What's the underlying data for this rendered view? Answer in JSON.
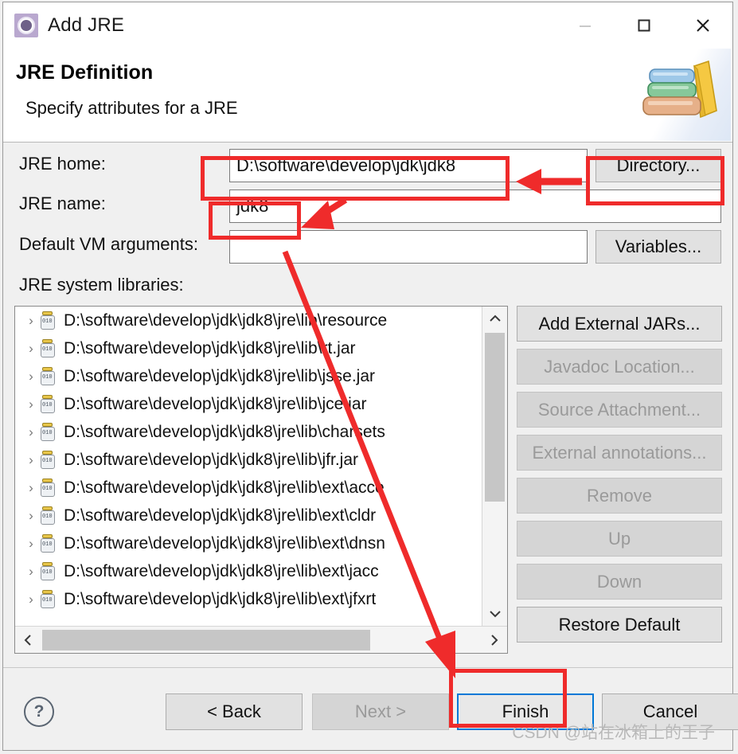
{
  "window": {
    "title": "Add JRE",
    "icon": "eclipse-jre-icon",
    "controls": {
      "minimize": "–",
      "maximize": "☐",
      "close": "✕"
    }
  },
  "header": {
    "title": "JRE Definition",
    "subtitle": "Specify attributes for a JRE",
    "art": "books-stack-image"
  },
  "form": {
    "jre_home": {
      "label": "JRE home:",
      "value": "D:\\software\\develop\\jdk\\jdk8",
      "button": "Directory..."
    },
    "jre_name": {
      "label": "JRE name:",
      "value": "jdk8"
    },
    "vm_args": {
      "label": "Default VM arguments:",
      "value": "",
      "button": "Variables..."
    },
    "libraries_label": "JRE system libraries:"
  },
  "libraries": [
    {
      "text": "D:\\software\\develop\\jdk\\jdk8\\jre\\lib\\resource",
      "icon": "jar-icon"
    },
    {
      "text": "D:\\software\\develop\\jdk\\jdk8\\jre\\lib\\rt.jar",
      "icon": "jar-icon"
    },
    {
      "text": "D:\\software\\develop\\jdk\\jdk8\\jre\\lib\\jsse.jar",
      "icon": "jar-icon"
    },
    {
      "text": "D:\\software\\develop\\jdk\\jdk8\\jre\\lib\\jce.jar",
      "icon": "jar-icon"
    },
    {
      "text": "D:\\software\\develop\\jdk\\jdk8\\jre\\lib\\charsets",
      "icon": "jar-icon"
    },
    {
      "text": "D:\\software\\develop\\jdk\\jdk8\\jre\\lib\\jfr.jar",
      "icon": "jar-icon"
    },
    {
      "text": "D:\\software\\develop\\jdk\\jdk8\\jre\\lib\\ext\\acce",
      "icon": "jar-icon"
    },
    {
      "text": "D:\\software\\develop\\jdk\\jdk8\\jre\\lib\\ext\\cldr",
      "icon": "jar-icon"
    },
    {
      "text": "D:\\software\\develop\\jdk\\jdk8\\jre\\lib\\ext\\dnsn",
      "icon": "jar-icon"
    },
    {
      "text": "D:\\software\\develop\\jdk\\jdk8\\jre\\lib\\ext\\jacc",
      "icon": "jar-icon"
    },
    {
      "text": "D:\\software\\develop\\jdk\\jdk8\\jre\\lib\\ext\\jfxrt",
      "icon": "jar-icon"
    }
  ],
  "side_buttons": [
    {
      "label": "Add External JARs...",
      "enabled": true
    },
    {
      "label": "Javadoc Location...",
      "enabled": false
    },
    {
      "label": "Source Attachment...",
      "enabled": false
    },
    {
      "label": "External annotations...",
      "enabled": false
    },
    {
      "label": "Remove",
      "enabled": false
    },
    {
      "label": "Up",
      "enabled": false
    },
    {
      "label": "Down",
      "enabled": false
    },
    {
      "label": "Restore Default",
      "enabled": true
    }
  ],
  "footer": {
    "help": "?",
    "back": "< Back",
    "next": "Next >",
    "finish": "Finish",
    "cancel": "Cancel"
  },
  "watermark": "CSDN @站在冰箱上的王子",
  "annotation_color": "#ef2b2b",
  "focus_color": "#0078d7"
}
